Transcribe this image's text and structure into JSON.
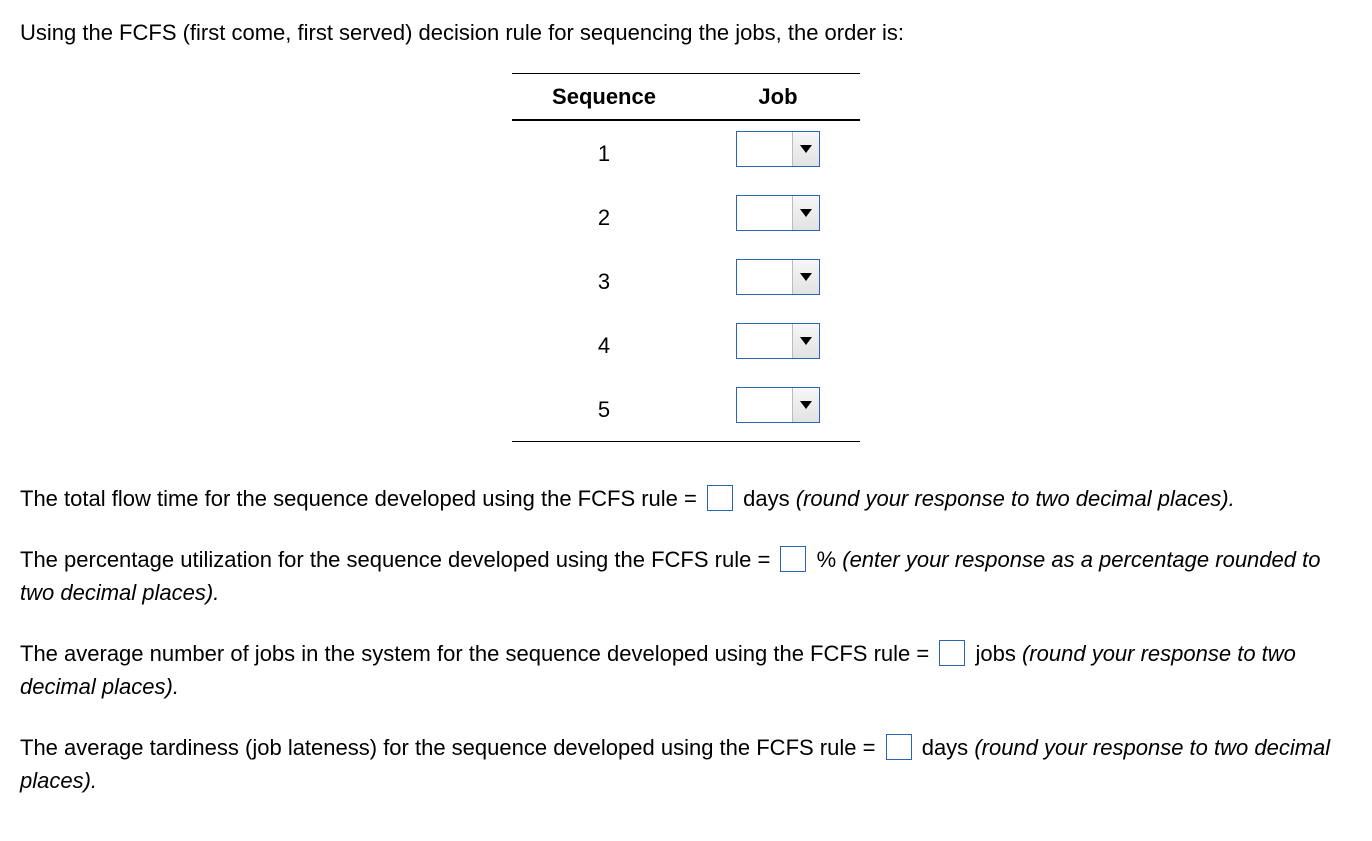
{
  "intro": "Using the FCFS (first come, first served) decision rule for sequencing the jobs, the order is:",
  "table": {
    "headers": {
      "sequence": "Sequence",
      "job": "Job"
    },
    "rows": [
      {
        "seq": "1"
      },
      {
        "seq": "2"
      },
      {
        "seq": "3"
      },
      {
        "seq": "4"
      },
      {
        "seq": "5"
      }
    ]
  },
  "q1": {
    "t1": "The total flow time for the sequence developed using the FCFS rule =",
    "t2": "days",
    "hint": "(round your response to two decimal places)."
  },
  "q2": {
    "t1": "The percentage utilization for the sequence developed using the FCFS rule =",
    "t2": "%",
    "hint": "(enter your response as a percentage rounded to two decimal places)."
  },
  "q3": {
    "t1": "The average number of jobs in the system for the sequence developed using the FCFS rule =",
    "t2": "jobs",
    "hint": "(round your response to two decimal places)."
  },
  "q4": {
    "t1": "The average tardiness (job lateness) for the sequence developed using the FCFS rule =",
    "t2": "days",
    "hint": "(round your response to two decimal places)."
  }
}
